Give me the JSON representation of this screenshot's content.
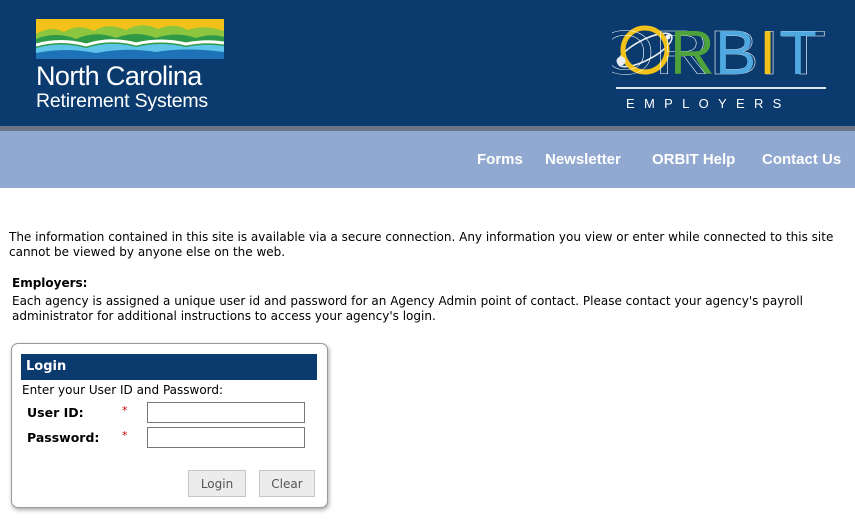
{
  "header": {
    "logo_name": "North Carolina",
    "logo_subtitle": "Retirement Systems",
    "orbit_title": "ORBIT",
    "orbit_subtitle": "EMPLOYERS"
  },
  "nav": {
    "items": [
      "Forms",
      "Newsletter",
      "ORBIT Help",
      "Contact Us"
    ]
  },
  "content": {
    "intro": "The information contained in this site is available via a secure connection. Any information you view or enter while connected to this site cannot be viewed by anyone else on the web.",
    "employers_heading": "Employers:",
    "employers_text": "Each agency is assigned a unique user id and password for an Agency Admin point of contact. Please contact your agency's payroll administrator for additional instructions to access your agency's login."
  },
  "login": {
    "title": "Login",
    "prompt": "Enter your User ID and Password:",
    "userid_label": "User ID:",
    "password_label": "Password:",
    "required_mark": "*",
    "userid_value": "",
    "password_value": "",
    "login_button": "Login",
    "clear_button": "Clear"
  },
  "colors": {
    "header_bg": "#0a3a6e",
    "navbar_bg": "#91a9d0",
    "required": "#cc0000"
  }
}
